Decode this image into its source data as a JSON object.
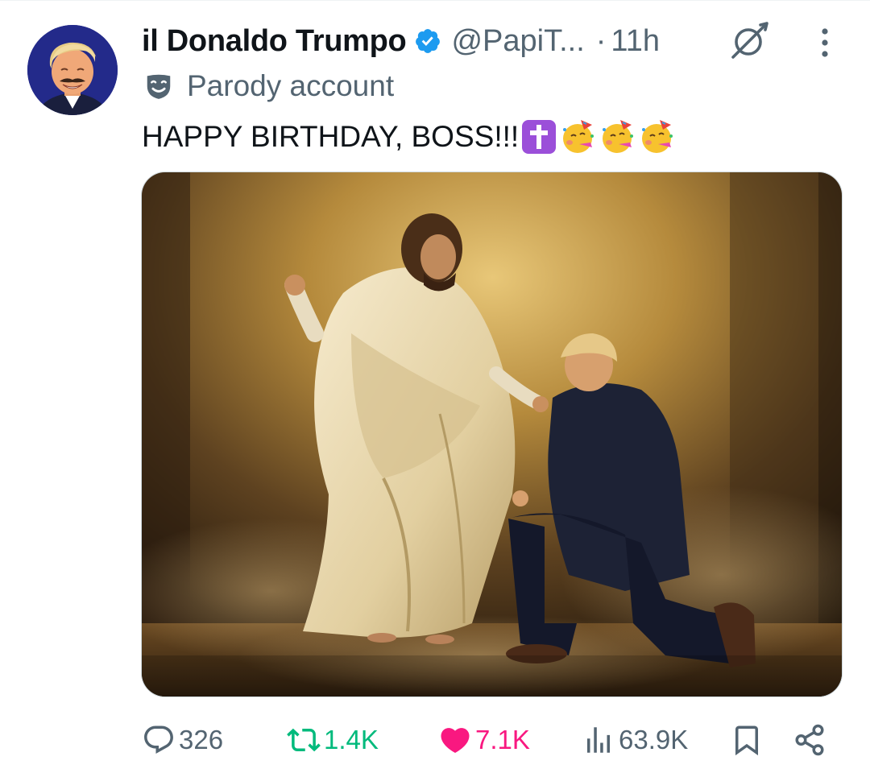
{
  "tweet": {
    "display_name": "il Donaldo Trumpo",
    "handle": "@PapiT...",
    "separator": "·",
    "time": "11h",
    "parody_label": "Parody account",
    "text": "HAPPY BIRTHDAY, BOSS!!!",
    "emojis": [
      "latin-cross-emoji",
      "partying-face-emoji",
      "partying-face-emoji",
      "partying-face-emoji"
    ]
  },
  "actions": {
    "replies": "326",
    "reposts": "1.4K",
    "likes": "7.1K",
    "views": "63.9K"
  },
  "icons": {
    "verified": "verified-badge-icon",
    "grok": "grok-icon",
    "more": "more-vertical-icon",
    "parody": "theater-mask-icon",
    "reply": "reply-icon",
    "repost": "repost-icon",
    "like": "heart-icon",
    "views": "views-icon",
    "bookmark": "bookmark-icon",
    "share": "share-icon"
  },
  "colors": {
    "text": "#0f1419",
    "secondary": "#536471",
    "verified": "#1d9bf0",
    "repost_active": "#00ba7c",
    "like_active": "#f91880"
  }
}
